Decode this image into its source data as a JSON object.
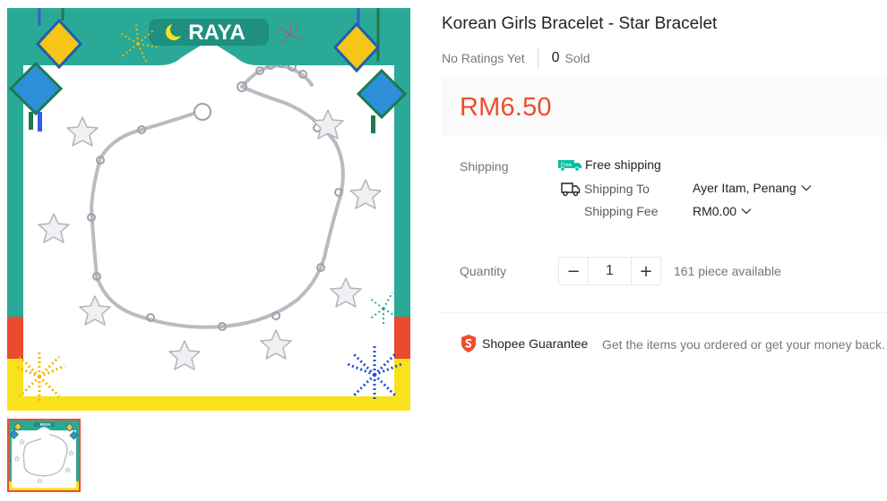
{
  "product": {
    "title": "Korean Girls Bracelet - Star Bracelet",
    "ratings_text": "No Ratings Yet",
    "sold_count": "0",
    "sold_label": "Sold",
    "price": "RM6.50"
  },
  "gallery": {
    "banner_text": "RAYA",
    "thumb_banner_text": "RAYA"
  },
  "shipping": {
    "label": "Shipping",
    "free_badge": "Free",
    "free_text": "Free shipping",
    "to_label": "Shipping To",
    "to_value": "Ayer Itam, Penang",
    "fee_label": "Shipping Fee",
    "fee_value": "RM0.00"
  },
  "quantity": {
    "label": "Quantity",
    "minus": "−",
    "plus": "+",
    "value": "1",
    "available": "161 piece available"
  },
  "guarantee": {
    "label": "Shopee Guarantee",
    "description": "Get the items you ordered or get your money back."
  },
  "colors": {
    "accent": "#ee4d2d",
    "free_shipping": "#00bfa5",
    "frame_teal": "#2aa997",
    "frame_yellow": "#f9e21d",
    "frame_red": "#ea4a2d"
  }
}
